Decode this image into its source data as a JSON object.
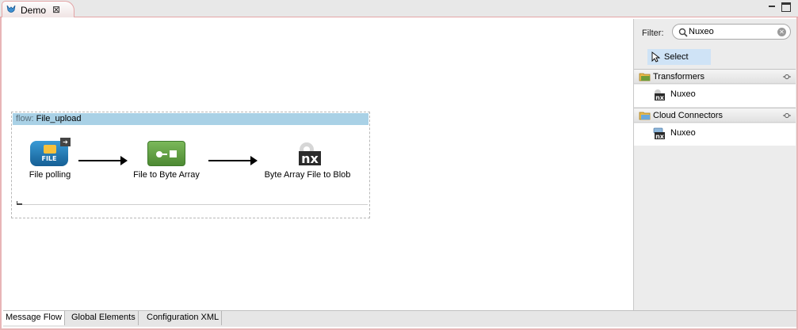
{
  "editor_tab": {
    "title": "Demo",
    "close_glyph": "⊠"
  },
  "flow": {
    "prefix": "flow:",
    "name": "File_upload",
    "nodes": [
      {
        "label": "File polling",
        "icon": "file-endpoint-icon",
        "icon_text": "FILE"
      },
      {
        "label": "File to Byte Array",
        "icon": "transformer-icon"
      },
      {
        "label": "Byte Array File to Blob",
        "icon": "nuxeo-icon",
        "icon_text": "nx"
      }
    ]
  },
  "palette": {
    "filter_label": "Filter:",
    "filter_value": "Nuxeo",
    "select_label": "Select",
    "drawers": [
      {
        "title": "Transformers",
        "items": [
          {
            "label": "Nuxeo"
          }
        ]
      },
      {
        "title": "Cloud Connectors",
        "items": [
          {
            "label": "Nuxeo"
          }
        ]
      }
    ]
  },
  "bottom_tabs": [
    {
      "label": "Message Flow",
      "active": true
    },
    {
      "label": "Global Elements",
      "active": false
    },
    {
      "label": "Configuration XML",
      "active": false
    }
  ],
  "colors": {
    "accent_border": "#e3a4a6",
    "flow_header": "#a9d1e6",
    "file_icon": "#1f74b0",
    "transformer_icon": "#5f9e41",
    "selection": "#cfe3f6"
  }
}
